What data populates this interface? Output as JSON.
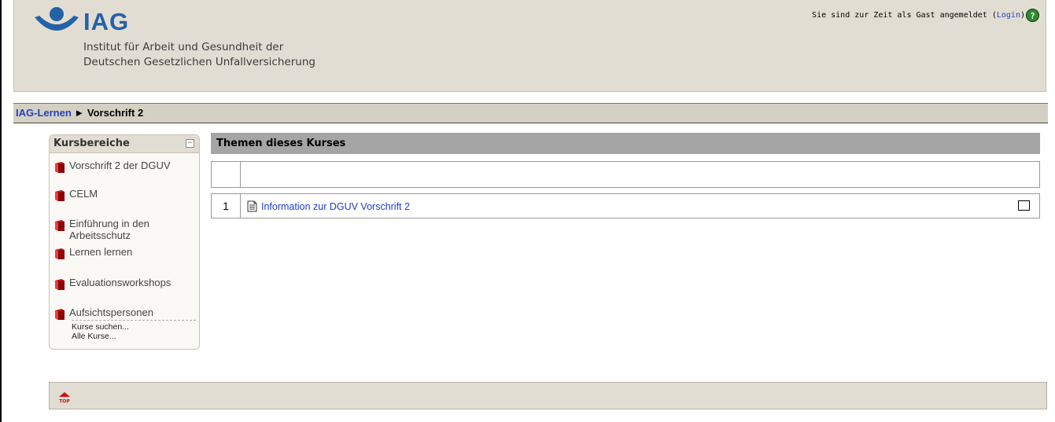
{
  "header": {
    "logo_word": "IAG",
    "logo_line1": "Institut für Arbeit und Gesundheit der",
    "logo_line2": "Deutschen Gesetzlichen Unfallversicherung",
    "login_text": "Sie sind zur Zeit als Gast angemeldet (",
    "login_link": "Login",
    "login_close": ")",
    "help_symbol": "?"
  },
  "breadcrumb": {
    "root": "IAG-Lernen",
    "separator": " ► ",
    "current": "Vorschrift 2"
  },
  "sidebar": {
    "title": "Kursbereiche",
    "collapse_symbol": "−",
    "items": [
      {
        "label": "Vorschrift 2 der DGUV"
      },
      {
        "label": "CELM"
      },
      {
        "label": "Einführung in den Arbeitsschutz"
      },
      {
        "label": "Lernen lernen"
      },
      {
        "label": "Evaluationsworkshops"
      },
      {
        "label": "Aufsichtspersonen"
      }
    ],
    "search_courses": "Kurse suchen...",
    "all_courses": "Alle Kurse..."
  },
  "main": {
    "title": "Themen dieses Kurses",
    "topics": [
      {
        "number": "",
        "resource": ""
      },
      {
        "number": "1",
        "resource": "Information zur DGUV Vorschrift 2"
      }
    ]
  },
  "colors": {
    "link": "#2244bb",
    "header_bg": "#e2ddd3",
    "book_red": "#cc1111",
    "main_header_bg": "#a5a5a5"
  },
  "icons": [
    "help-icon",
    "book-icon",
    "document-icon",
    "top-arrow-icon",
    "collapse-icon"
  ]
}
